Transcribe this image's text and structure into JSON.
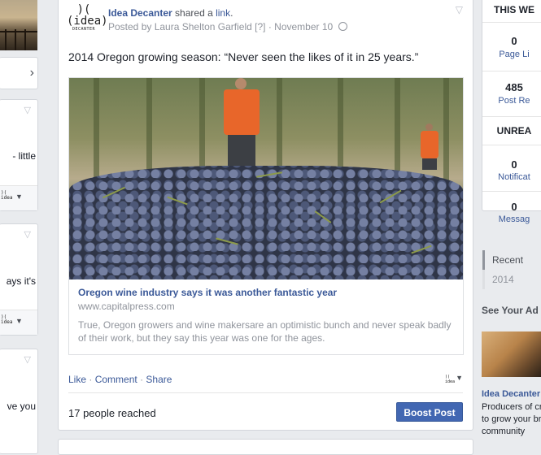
{
  "left_column": {
    "items": [
      {
        "text": "- little"
      },
      {
        "text": "ays it's"
      },
      {
        "text": "ve you"
      }
    ]
  },
  "post": {
    "page_name": "Idea Decanter",
    "action_text": "shared a",
    "action_link": "link",
    "action_end": ".",
    "posted_by": "Posted by Laura Shelton Garfield",
    "help_marker": "[?]",
    "date_sep": "·",
    "date": "November 10",
    "logo_top": ")(",
    "logo_mid": "(idea)",
    "logo_sub": "DECANTER",
    "message": "2014 Oregon growing season: “Never seen the likes of it in 25 years.”",
    "link": {
      "title": "Oregon wine industry says it was another fantastic year",
      "url": "www.capitalpress.com",
      "description": "True, Oregon growers and wine makersare an optimistic bunch and never speak badly of their work, but they say this year was one for the ages."
    },
    "actions": {
      "like": "Like",
      "comment": "Comment",
      "share": "Share",
      "sep": "·"
    },
    "reach": "17 people reached",
    "boost": "Boost Post"
  },
  "stats": {
    "header1": "THIS WE",
    "page_likes_value": "0",
    "page_likes_label": "Page Li",
    "post_reach_value": "485",
    "post_reach_label": "Post Re",
    "header2": "UNREA",
    "notifications_value": "0",
    "notifications_label": "Notificat",
    "messages_value": "0",
    "messages_label": "Messag"
  },
  "timeline": {
    "recent": "Recent",
    "year": "2014"
  },
  "ads": {
    "heading": "See Your Ad",
    "title": "Idea Decanter",
    "body_lines": [
      "Producers of cr",
      "to grow your br",
      "community"
    ]
  },
  "colors": {
    "link_blue": "#3b5998",
    "boost_button": "#4267b2",
    "background": "#e9ebee"
  }
}
